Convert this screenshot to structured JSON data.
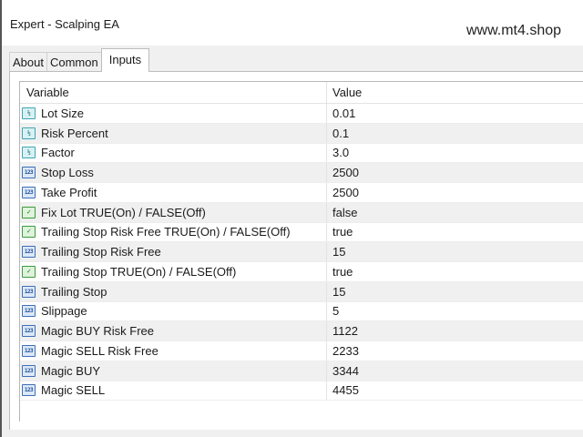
{
  "window": {
    "title": "Expert - Scalping EA"
  },
  "watermark": "www.mt4.shop",
  "tabs": [
    {
      "label": "About",
      "active": false
    },
    {
      "label": "Common",
      "active": false
    },
    {
      "label": "Inputs",
      "active": true
    }
  ],
  "table": {
    "headers": {
      "variable": "Variable",
      "value": "Value"
    },
    "icon_types": {
      "frac": "fraction-icon",
      "int": "integer-icon",
      "bool": "boolean-icon"
    },
    "rows": [
      {
        "type": "frac",
        "name": "Lot Size",
        "value": "0.01"
      },
      {
        "type": "frac",
        "name": "Risk Percent",
        "value": "0.1"
      },
      {
        "type": "frac",
        "name": "Factor",
        "value": "3.0"
      },
      {
        "type": "int",
        "name": "Stop Loss",
        "value": "2500"
      },
      {
        "type": "int",
        "name": "Take Profit",
        "value": "2500"
      },
      {
        "type": "bool",
        "name": "Fix Lot TRUE(On) / FALSE(Off)",
        "value": "false"
      },
      {
        "type": "bool",
        "name": "Trailing Stop Risk Free TRUE(On) / FALSE(Off)",
        "value": "true"
      },
      {
        "type": "int",
        "name": "Trailing Stop Risk Free",
        "value": "15"
      },
      {
        "type": "bool",
        "name": "Trailing Stop TRUE(On) / FALSE(Off)",
        "value": "true"
      },
      {
        "type": "int",
        "name": "Trailing Stop",
        "value": "15"
      },
      {
        "type": "int",
        "name": "Slippage",
        "value": "5"
      },
      {
        "type": "int",
        "name": "Magic BUY Risk Free",
        "value": "1122"
      },
      {
        "type": "int",
        "name": "Magic SELL Risk Free",
        "value": "2233"
      },
      {
        "type": "int",
        "name": "Magic BUY",
        "value": "3344"
      },
      {
        "type": "int",
        "name": "Magic SELL",
        "value": "4455"
      }
    ]
  }
}
